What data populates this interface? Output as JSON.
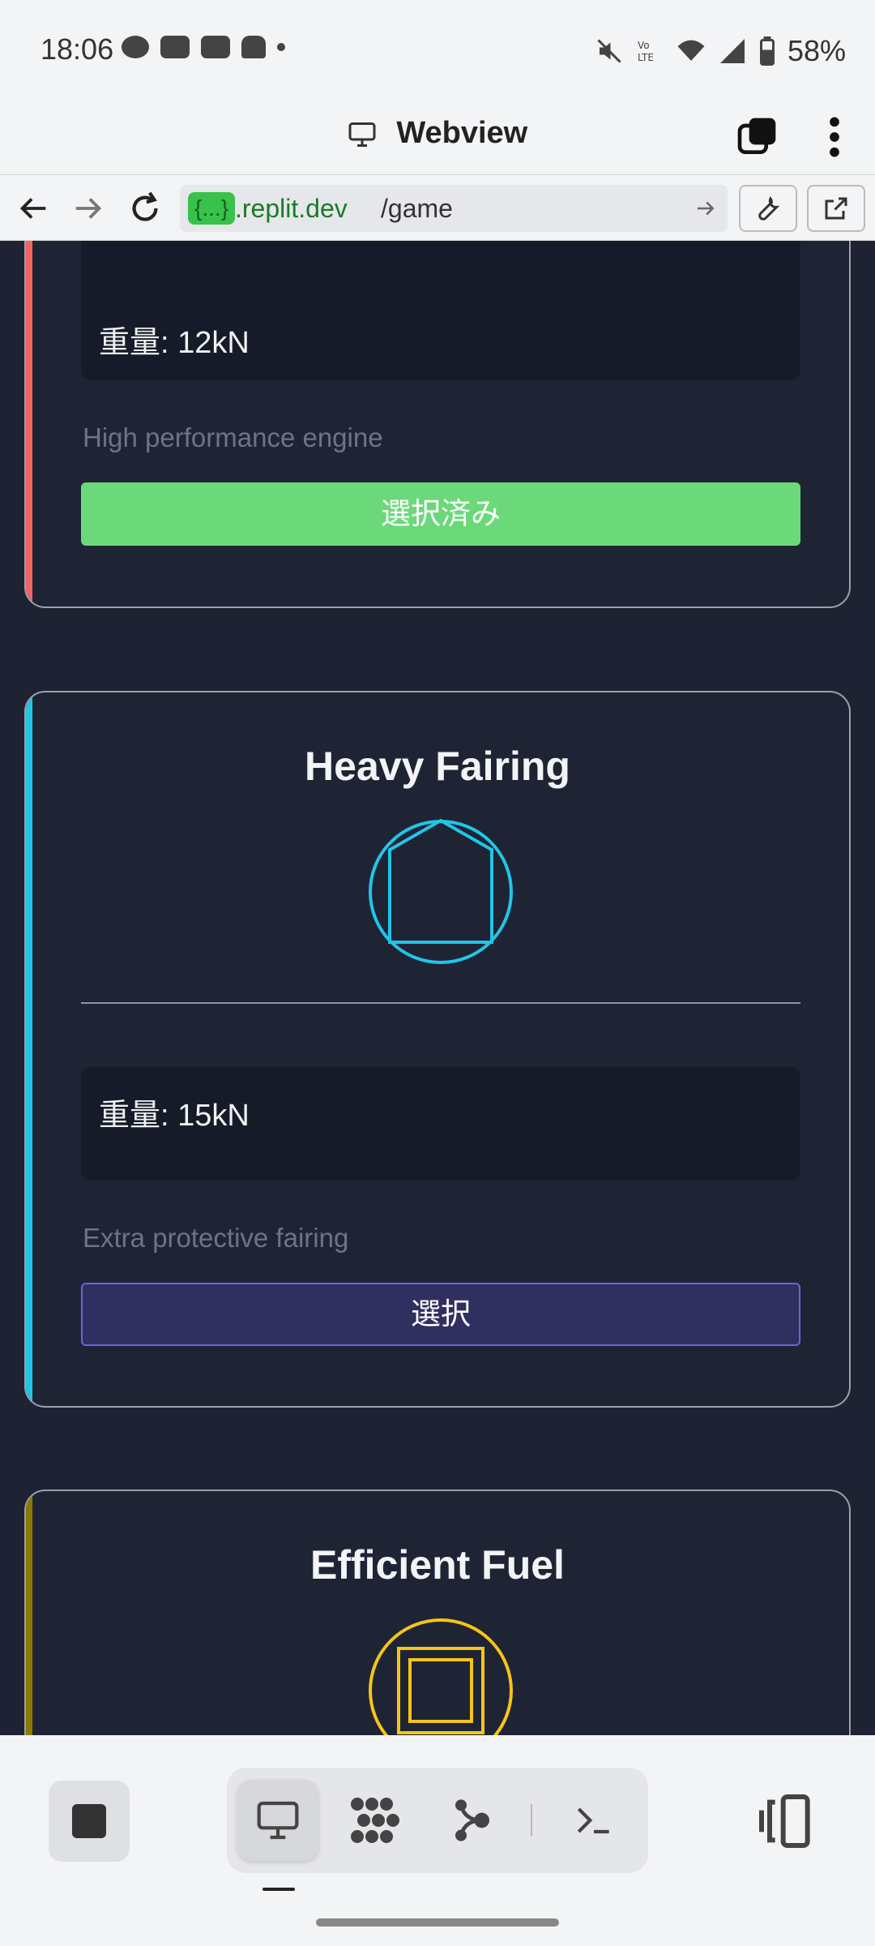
{
  "status_bar": {
    "time": "18:06",
    "battery": "58%",
    "icons_left": [
      "pig-icon",
      "youtube-icon",
      "youtube-icon",
      "bunny-icon",
      "dot-icon"
    ],
    "icons_right": [
      "mute-icon",
      "volte-icon",
      "wifi-icon",
      "signal-icon",
      "battery-icon"
    ]
  },
  "webview": {
    "title": "Webview"
  },
  "url_bar": {
    "badge": "{...}",
    "domain": ".replit.dev",
    "path": "/game"
  },
  "cards": [
    {
      "title": "",
      "stat": "重量: 12kN",
      "description": "High performance engine",
      "button": "選択済み",
      "accent": "#f26363"
    },
    {
      "title": "Heavy Fairing",
      "stat": "重量: 15kN",
      "description": "Extra protective fairing",
      "button": "選択",
      "accent": "#22c5e6"
    },
    {
      "title": "Efficient Fuel",
      "accent": "#8a7a00"
    }
  ],
  "colors": {
    "page_bg": "#1e2232",
    "selected_button": "#6bd97a",
    "select_button": "#2f2f60"
  }
}
